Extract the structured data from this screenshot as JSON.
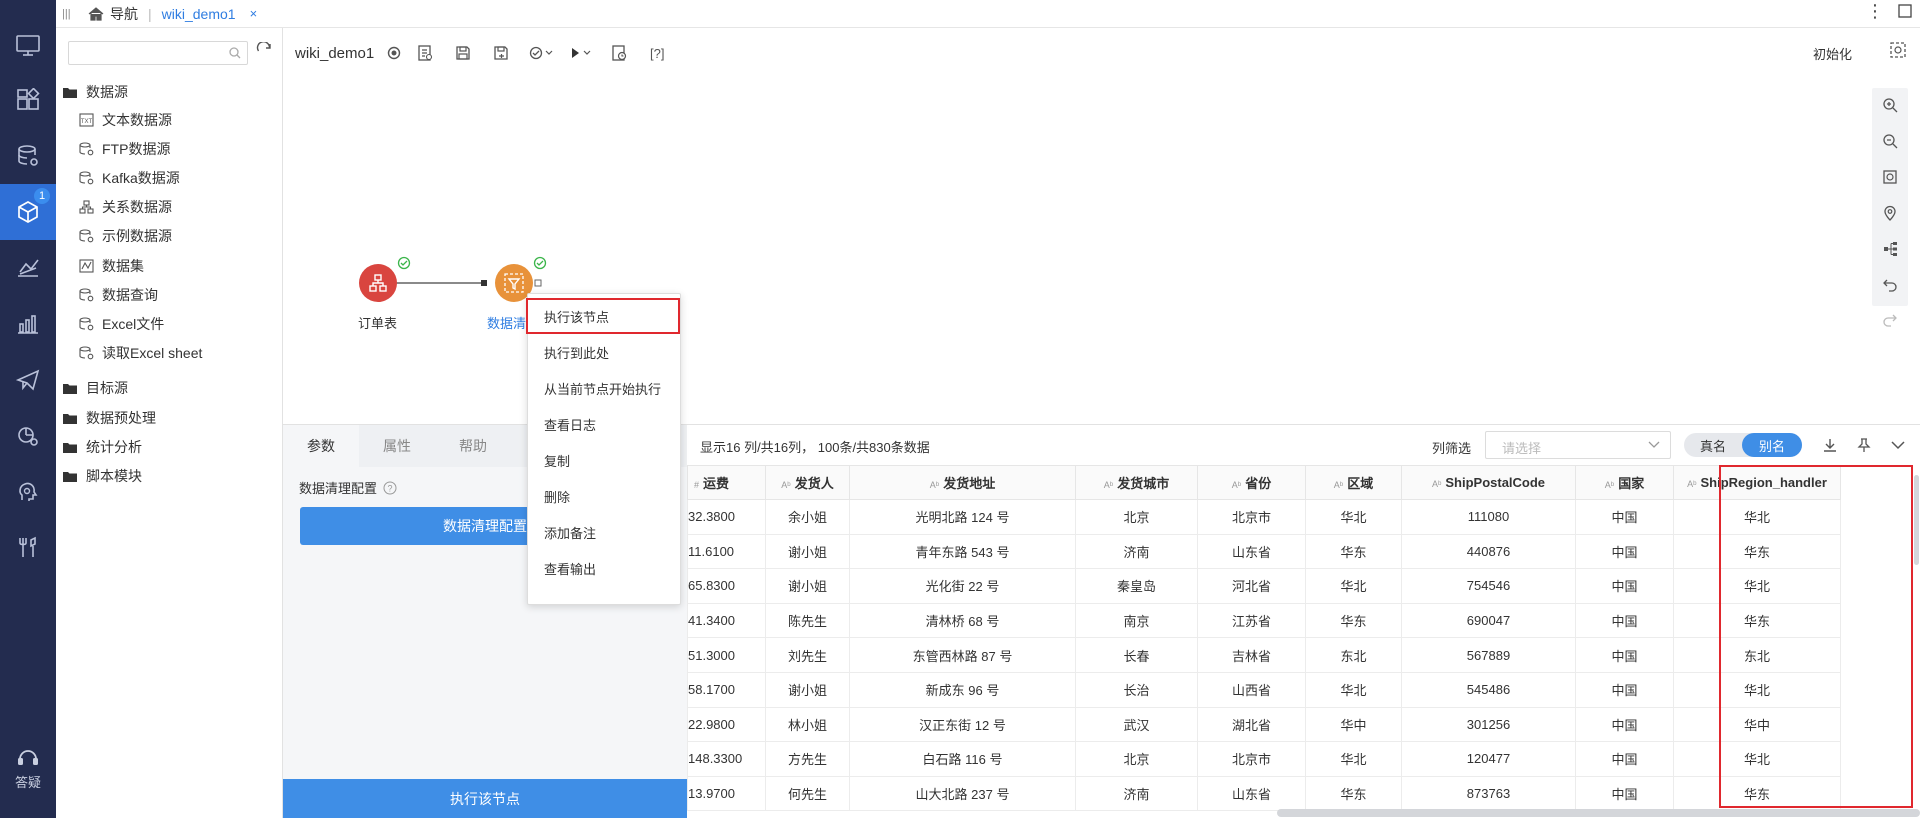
{
  "top": {
    "nav_label": "导航",
    "tab": "wiki_demo1",
    "close_glyph": "×"
  },
  "left_nav": {
    "badge": "1",
    "help_label": "答疑"
  },
  "tree": {
    "items": [
      {
        "label": "数据源",
        "icon": "folder-icon"
      },
      {
        "label": "文本数据源",
        "icon": "text-source-icon"
      },
      {
        "label": "FTP数据源",
        "icon": "database-icon"
      },
      {
        "label": "Kafka数据源",
        "icon": "database-icon"
      },
      {
        "label": "关系数据源",
        "icon": "relation-icon"
      },
      {
        "label": "示例数据源",
        "icon": "database-icon"
      },
      {
        "label": "数据集",
        "icon": "dataset-icon"
      },
      {
        "label": "数据查询",
        "icon": "database-icon"
      },
      {
        "label": "Excel文件",
        "icon": "database-icon"
      },
      {
        "label": "读取Excel sheet",
        "icon": "database-icon"
      },
      {
        "label": "目标源",
        "icon": "folder-icon"
      },
      {
        "label": "数据预处理",
        "icon": "folder-icon"
      },
      {
        "label": "统计分析",
        "icon": "folder-icon"
      },
      {
        "label": "脚本模块",
        "icon": "folder-icon"
      }
    ]
  },
  "canvas": {
    "title": "wiki_demo1",
    "help_text": "[?]",
    "init_label": "初始化",
    "nodes": [
      {
        "label": "订单表",
        "color": "#d9453f"
      },
      {
        "label": "数据清",
        "color": "#e8923a"
      }
    ]
  },
  "context_menu": {
    "items": [
      "执行该节点",
      "执行到此处",
      "从当前节点开始执行",
      "查看日志",
      "复制",
      "删除",
      "添加备注",
      "查看输出"
    ]
  },
  "bottom_panel": {
    "tabs": [
      "参数",
      "属性",
      "帮助"
    ],
    "config_label": "数据清理配置",
    "config_button": "数据清理配置",
    "run_button": "执行该节点"
  },
  "preview": {
    "info": "显示16 列/共16列， 100条/共830条数据",
    "filter_label": "列筛选",
    "filter_placeholder": "请选择",
    "toggle_real": "真名",
    "toggle_alias": "别名",
    "columns": [
      {
        "type": "#",
        "name": "运费"
      },
      {
        "type": "Aᵇ",
        "name": "发货人"
      },
      {
        "type": "Aᵇ",
        "name": "发货地址"
      },
      {
        "type": "Aᵇ",
        "name": "发货城市"
      },
      {
        "type": "Aᵇ",
        "name": "省份"
      },
      {
        "type": "Aᵇ",
        "name": "区域"
      },
      {
        "type": "Aᵇ",
        "name": "ShipPostalCode"
      },
      {
        "type": "Aᵇ",
        "name": "国家"
      },
      {
        "type": "Aᵇ",
        "name": "ShipRegion_handler"
      }
    ],
    "rows": [
      [
        "32.3800",
        "余小姐",
        "光明北路 124 号",
        "北京",
        "北京市",
        "华北",
        "111080",
        "中国",
        "华北"
      ],
      [
        "11.6100",
        "谢小姐",
        "青年东路 543 号",
        "济南",
        "山东省",
        "华东",
        "440876",
        "中国",
        "华东"
      ],
      [
        "65.8300",
        "谢小姐",
        "光化街 22 号",
        "秦皇岛",
        "河北省",
        "华北",
        "754546",
        "中国",
        "华北"
      ],
      [
        "41.3400",
        "陈先生",
        "清林桥 68 号",
        "南京",
        "江苏省",
        "华东",
        "690047",
        "中国",
        "华东"
      ],
      [
        "51.3000",
        "刘先生",
        "东管西林路 87 号",
        "长春",
        "吉林省",
        "东北",
        "567889",
        "中国",
        "东北"
      ],
      [
        "58.1700",
        "谢小姐",
        "新成东 96 号",
        "长治",
        "山西省",
        "华北",
        "545486",
        "中国",
        "华北"
      ],
      [
        "22.9800",
        "林小姐",
        "汉正东街 12 号",
        "武汉",
        "湖北省",
        "华中",
        "301256",
        "中国",
        "华中"
      ],
      [
        "148.3300",
        "方先生",
        "白石路 116 号",
        "北京",
        "北京市",
        "华北",
        "120477",
        "中国",
        "华北"
      ],
      [
        "13.9700",
        "何先生",
        "山大北路 237 号",
        "济南",
        "山东省",
        "华东",
        "873763",
        "中国",
        "华东"
      ]
    ]
  }
}
